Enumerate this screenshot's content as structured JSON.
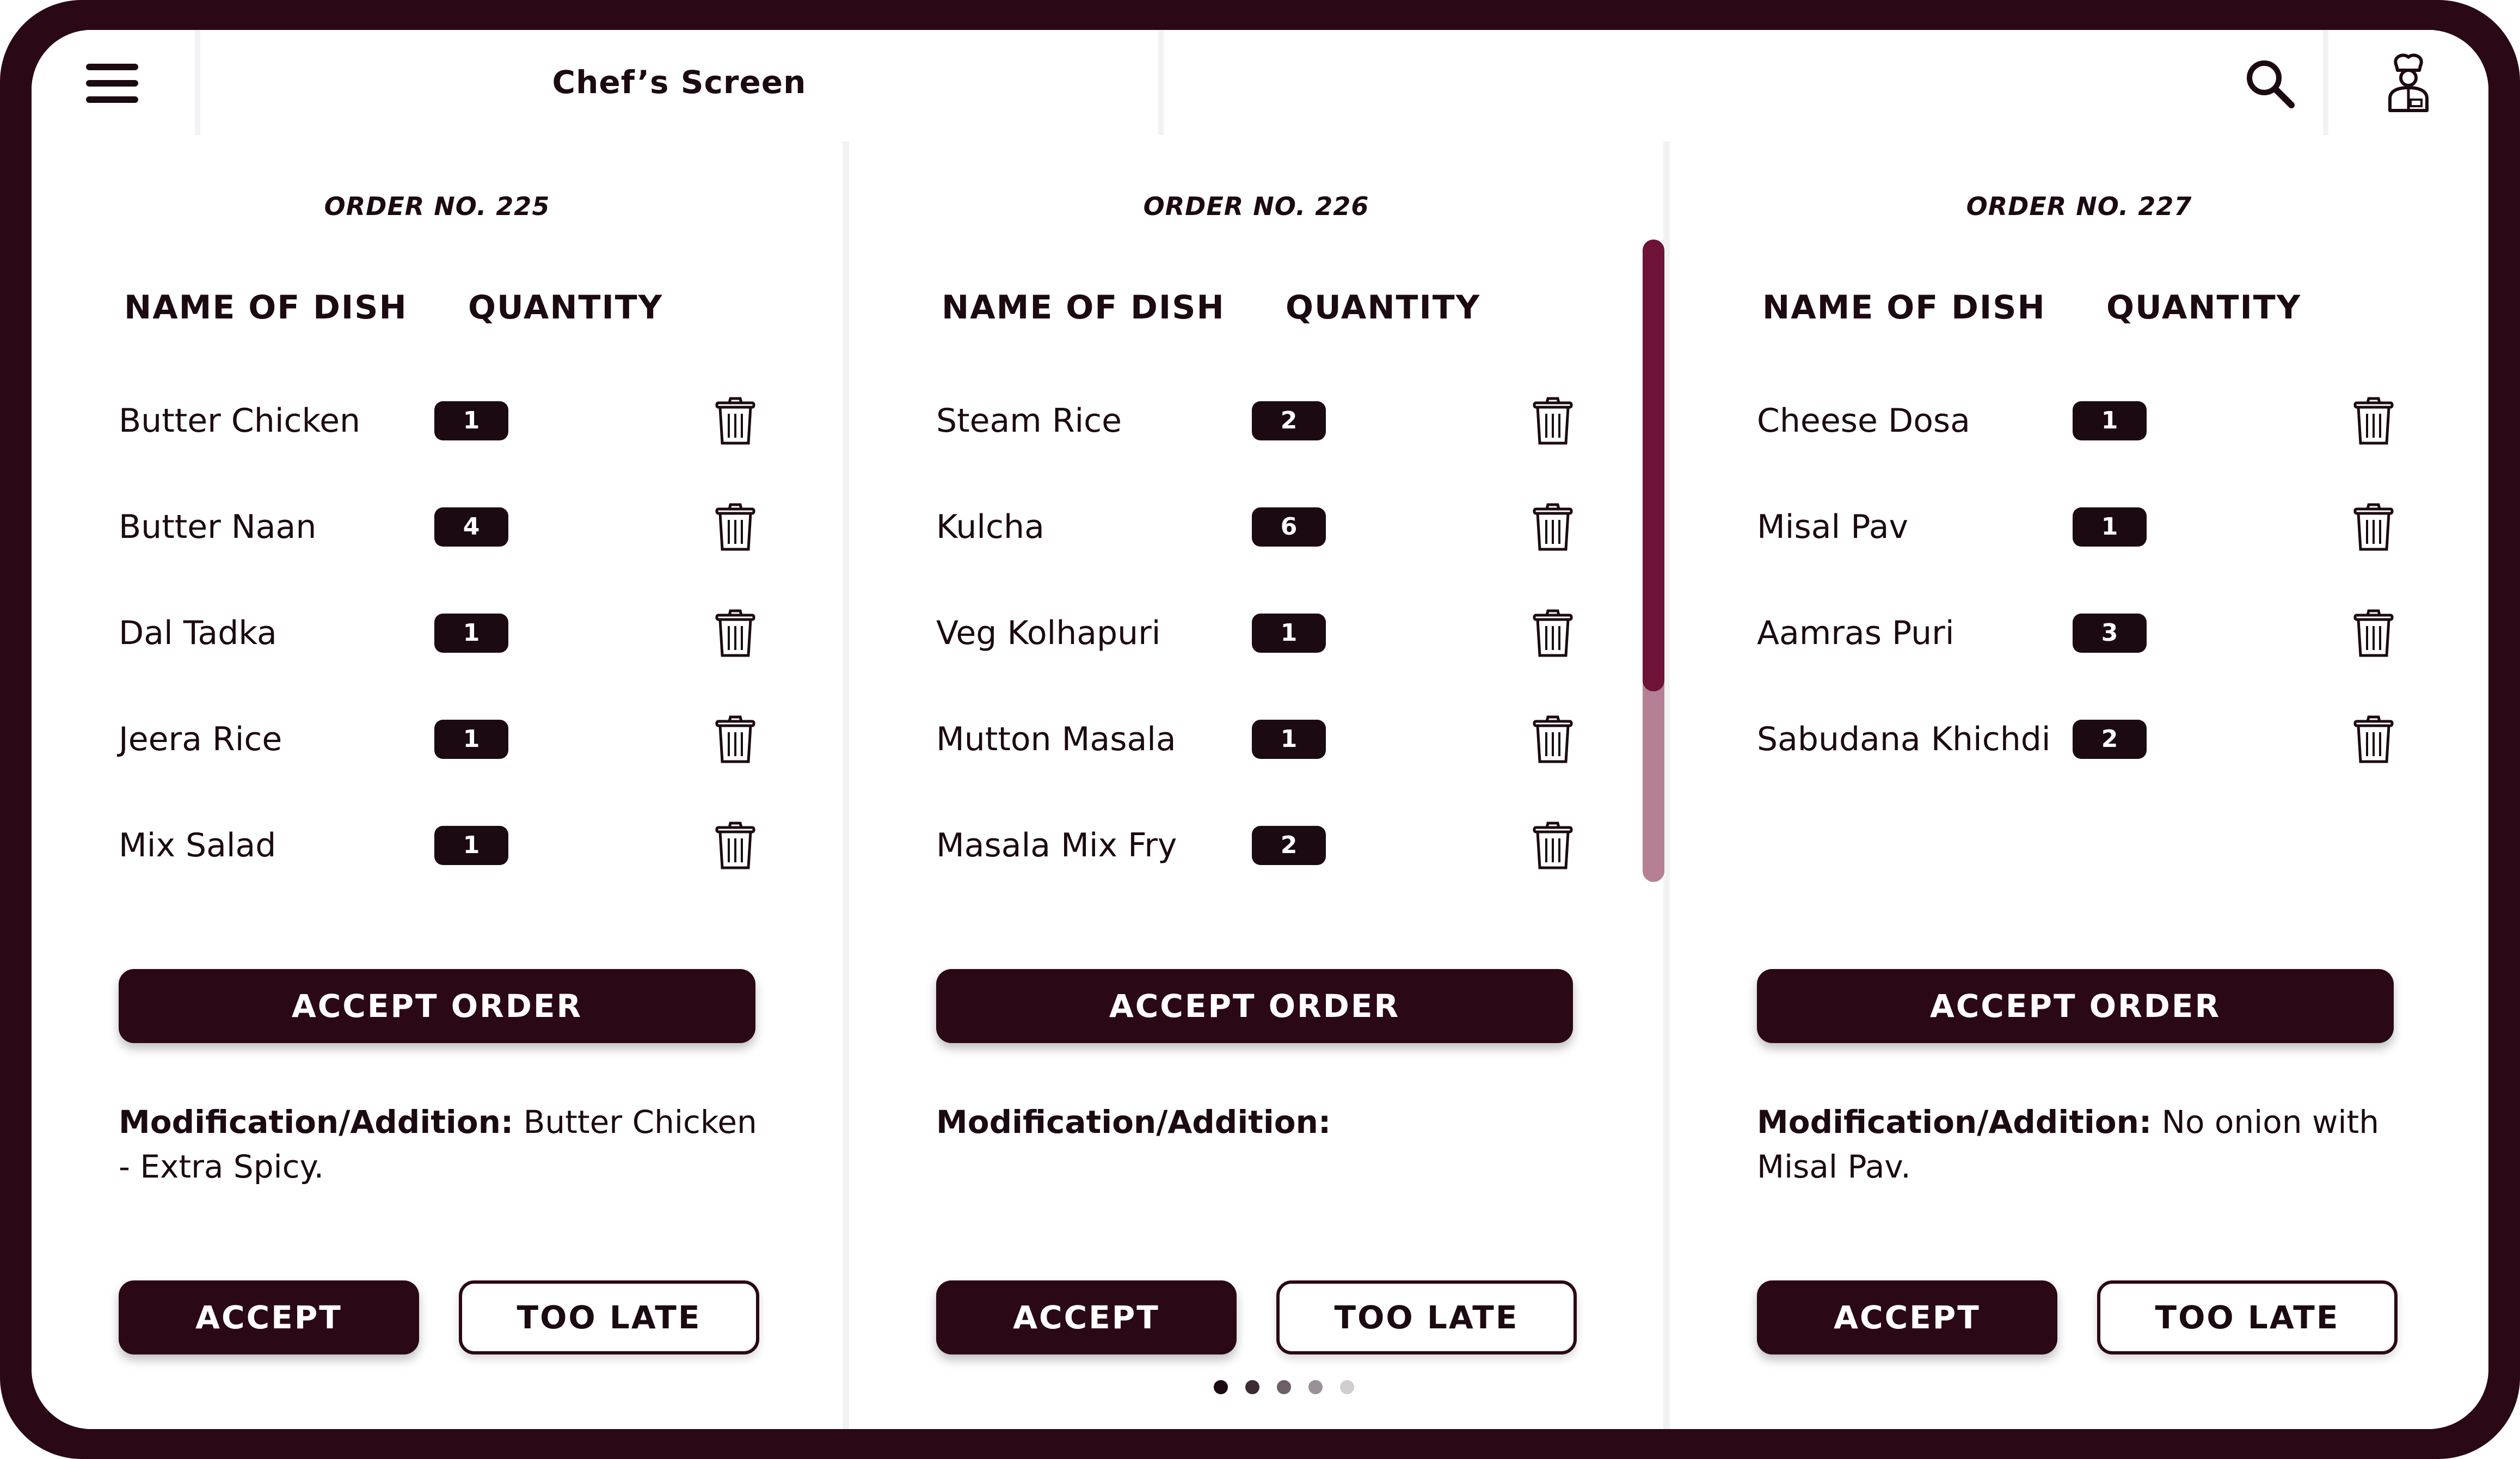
{
  "app": {
    "title": "Chef’s Screen"
  },
  "headers": {
    "dish": "NAME OF DISH",
    "quantity": "QUANTITY"
  },
  "colors": {
    "primary": "#2a0816",
    "scroll_thumb": "#6e1238",
    "scroll_track": "#b58094"
  },
  "icons": {
    "menu": "hamburger-icon",
    "search": "search-icon",
    "user": "chef-icon",
    "delete": "trash-icon"
  },
  "orders": [
    {
      "order_no": "ORDER NO. 225",
      "items": [
        {
          "dish": "Butter Chicken",
          "qty": "1"
        },
        {
          "dish": "Butter Naan",
          "qty": "4"
        },
        {
          "dish": "Dal Tadka",
          "qty": "1"
        },
        {
          "dish": "Jeera Rice",
          "qty": "1"
        },
        {
          "dish": "Mix Salad",
          "qty": "1"
        }
      ],
      "accept_order_label": "ACCEPT ORDER",
      "mod_label": "Modification/Addition:",
      "mod_text": "Butter Chicken - Extra Spicy.",
      "accept_label": "ACCEPT",
      "too_late_label": "TOO LATE"
    },
    {
      "order_no": "ORDER NO. 226",
      "items": [
        {
          "dish": "Steam Rice",
          "qty": "2"
        },
        {
          "dish": "Kulcha",
          "qty": "6"
        },
        {
          "dish": "Veg Kolhapuri",
          "qty": "1"
        },
        {
          "dish": "Mutton Masala",
          "qty": "1"
        },
        {
          "dish": "Masala Mix Fry",
          "qty": "2"
        }
      ],
      "accept_order_label": "ACCEPT ORDER",
      "mod_label": "Modification/Addition:",
      "mod_text": "",
      "accept_label": "ACCEPT",
      "too_late_label": "TOO LATE"
    },
    {
      "order_no": "ORDER NO. 227",
      "items": [
        {
          "dish": "Cheese Dosa",
          "qty": "1"
        },
        {
          "dish": "Misal Pav",
          "qty": "1"
        },
        {
          "dish": "Aamras Puri",
          "qty": "3"
        },
        {
          "dish": "Sabudana Khichdi",
          "qty": "2"
        }
      ],
      "accept_order_label": "ACCEPT ORDER",
      "mod_label": "Modification/Addition:",
      "mod_text": "No onion with Misal Pav.",
      "accept_label": "ACCEPT",
      "too_late_label": "TOO LATE"
    }
  ],
  "pagination": {
    "pages": 5,
    "current": 1
  }
}
